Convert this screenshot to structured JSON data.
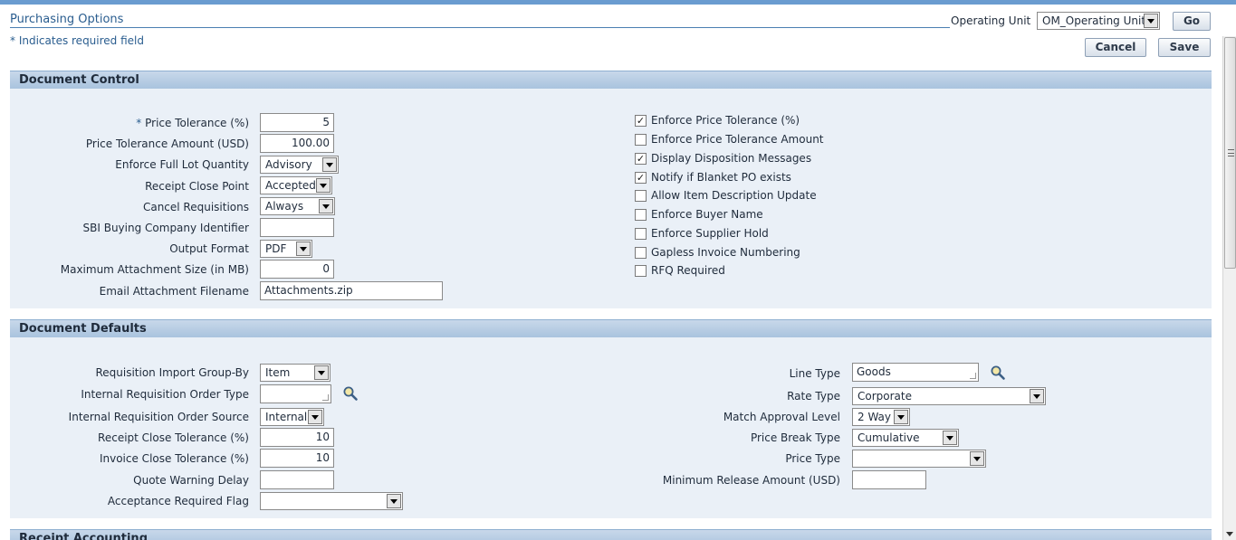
{
  "header": {
    "page_title": "Purchasing Options",
    "required_note": "*  Indicates required field",
    "operating_unit_label": "Operating Unit",
    "operating_unit_value": "OM_Operating Unit",
    "go_label": "Go",
    "cancel_label": "Cancel",
    "save_label": "Save"
  },
  "document_control": {
    "title": "Document Control",
    "fields": {
      "price_tolerance": {
        "label": "Price Tolerance (%)",
        "required_mark": "*",
        "value": "5"
      },
      "price_tolerance_amount": {
        "label": "Price Tolerance Amount (USD)",
        "value": "100.00"
      },
      "enforce_full_lot": {
        "label": "Enforce Full Lot Quantity",
        "value": "Advisory"
      },
      "receipt_close_point": {
        "label": "Receipt Close Point",
        "value": "Accepted"
      },
      "cancel_requisitions": {
        "label": "Cancel Requisitions",
        "value": "Always"
      },
      "sbi_identifier": {
        "label": "SBI Buying Company Identifier",
        "value": ""
      },
      "output_format": {
        "label": "Output Format",
        "value": "PDF"
      },
      "max_attachment_size": {
        "label": "Maximum Attachment Size (in MB)",
        "value": "0"
      },
      "email_attachment_filename": {
        "label": "Email Attachment Filename",
        "value": "Attachments.zip"
      }
    },
    "checkboxes": [
      {
        "label": "Enforce Price Tolerance (%)",
        "checked": true
      },
      {
        "label": "Enforce Price Tolerance Amount",
        "checked": false
      },
      {
        "label": "Display Disposition Messages",
        "checked": true
      },
      {
        "label": "Notify if Blanket PO exists",
        "checked": true
      },
      {
        "label": "Allow Item Description Update",
        "checked": false
      },
      {
        "label": "Enforce Buyer Name",
        "checked": false
      },
      {
        "label": "Enforce Supplier Hold",
        "checked": false
      },
      {
        "label": "Gapless Invoice Numbering",
        "checked": false
      },
      {
        "label": "RFQ Required",
        "checked": false
      }
    ]
  },
  "document_defaults": {
    "title": "Document Defaults",
    "left": {
      "req_import_group_by": {
        "label": "Requisition Import Group-By",
        "value": "Item"
      },
      "internal_req_order_type": {
        "label": "Internal Requisition Order Type",
        "value": ""
      },
      "internal_req_order_source": {
        "label": "Internal Requisition Order Source",
        "value": "Internal"
      },
      "receipt_close_tolerance": {
        "label": "Receipt Close Tolerance (%)",
        "value": "10"
      },
      "invoice_close_tolerance": {
        "label": "Invoice Close Tolerance (%)",
        "value": "10"
      },
      "quote_warning_delay": {
        "label": "Quote Warning Delay",
        "value": ""
      },
      "acceptance_required_flag": {
        "label": "Acceptance Required Flag",
        "value": ""
      }
    },
    "right": {
      "line_type": {
        "label": "Line Type",
        "value": "Goods"
      },
      "rate_type": {
        "label": "Rate Type",
        "value": "Corporate"
      },
      "match_approval_level": {
        "label": "Match Approval Level",
        "value": "2 Way"
      },
      "price_break_type": {
        "label": "Price Break Type",
        "value": "Cumulative"
      },
      "price_type": {
        "label": "Price Type",
        "value": ""
      },
      "min_release_amount": {
        "label": "Minimum Release Amount (USD)",
        "value": ""
      }
    }
  },
  "receipt_accounting": {
    "title": "Receipt Accounting"
  },
  "icons": {
    "search": "search-icon",
    "dropdown": "chevron-down-icon",
    "checkbox": "checkbox-icon"
  }
}
